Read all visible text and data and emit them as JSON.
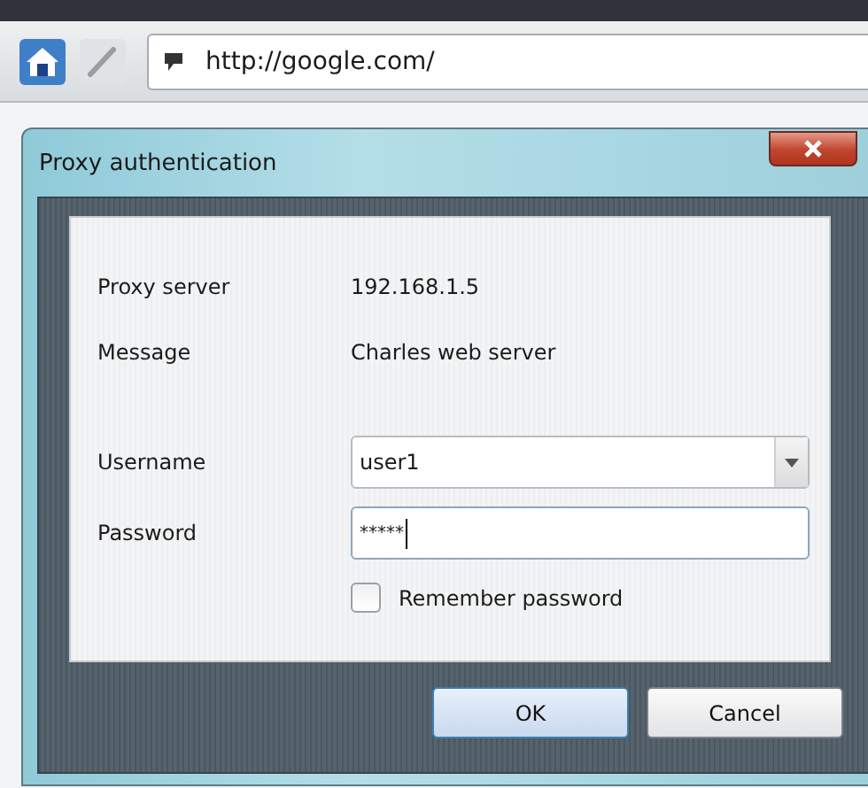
{
  "toolbar": {
    "url": "http://google.com/"
  },
  "dialog": {
    "title": "Proxy authentication",
    "info": [
      {
        "label": "Proxy server",
        "value": "192.168.1.5"
      },
      {
        "label": "Message",
        "value": "Charles web server"
      }
    ],
    "fields": [
      {
        "label": "Username",
        "kind": "combo",
        "value": "user1",
        "focused": false
      },
      {
        "label": "Password",
        "kind": "password",
        "value": "*****",
        "focused": true
      }
    ],
    "remember": {
      "label": "Remember password",
      "checked": false
    },
    "buttons": [
      {
        "label": "OK",
        "default": true
      },
      {
        "label": "Cancel",
        "default": false
      }
    ]
  }
}
